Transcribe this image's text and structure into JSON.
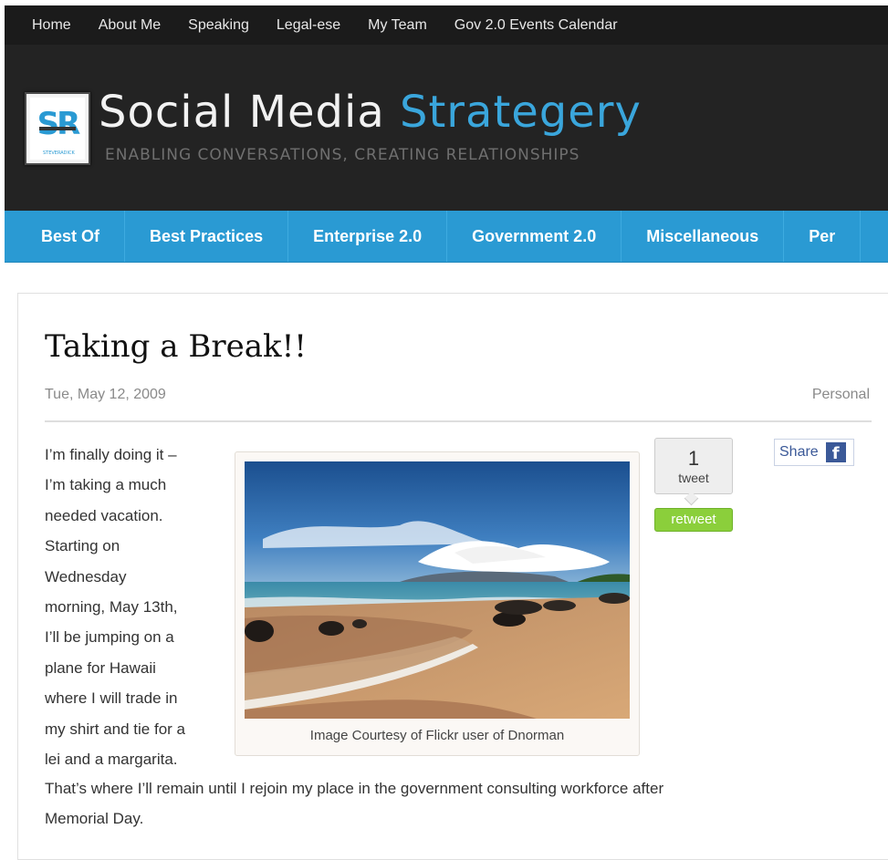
{
  "top_nav": {
    "items": [
      {
        "label": "Home"
      },
      {
        "label": "About Me"
      },
      {
        "label": "Speaking"
      },
      {
        "label": "Legal-ese"
      },
      {
        "label": "My Team"
      },
      {
        "label": "Gov 2.0 Events Calendar"
      }
    ]
  },
  "header": {
    "title_part1": "Social Media",
    "title_part2": "Strategery",
    "tagline": "ENABLING CONVERSATIONS, CREATING RELATIONSHIPS",
    "logo_letters": "SR",
    "logo_small_text": "STEVERADICK",
    "colors": {
      "accent": "#3aa6dc",
      "header_bg": "#232323",
      "nav_bg": "#1b1b1b",
      "category_bg": "#2a9ad3"
    }
  },
  "category_nav": {
    "items": [
      {
        "label": "Best Of"
      },
      {
        "label": "Best Practices"
      },
      {
        "label": "Enterprise 2.0"
      },
      {
        "label": "Government 2.0"
      },
      {
        "label": "Miscellaneous"
      },
      {
        "label": "Per"
      }
    ]
  },
  "post": {
    "title": "Taking a Break!!",
    "date": "Tue, May 12, 2009",
    "category": "Personal",
    "body_lines": [
      "I’m finally doing it –",
      "I’m taking a much",
      "needed vacation.",
      "Starting on",
      "Wednesday",
      "morning, May 13th,",
      "I’ll be jumping on a",
      "plane for Hawaii",
      "where I will trade in",
      "my shirt and tie for a",
      "lei and a margarita."
    ],
    "body_wide_lines": [
      "That’s where I’ll remain until I rejoin my place in the  government consulting workforce after",
      "Memorial Day."
    ],
    "image_caption": "Image Courtesy of Flickr user of Dnorman"
  },
  "tweet_widget": {
    "count": "1",
    "label": "tweet",
    "retweet_label": "retweet"
  },
  "facebook_share": {
    "label": "Share",
    "icon": "facebook-icon"
  }
}
